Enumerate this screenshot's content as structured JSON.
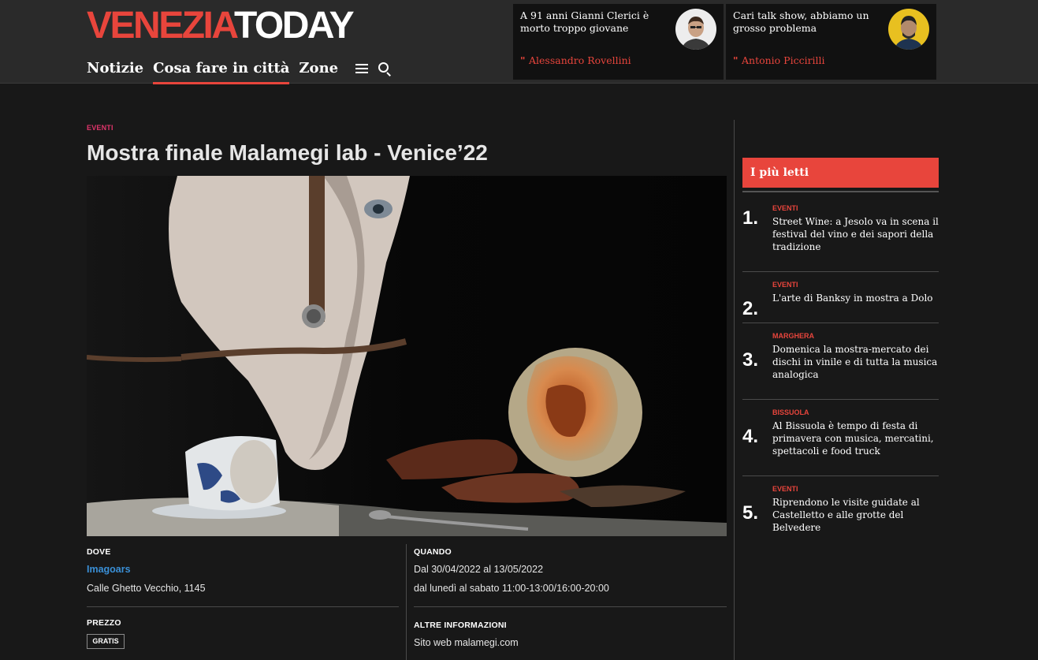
{
  "header": {
    "logo_part1": "VENEZIA",
    "logo_part2": "TODAY",
    "nav": [
      "Notizie",
      "Cosa fare in città",
      "Zone"
    ],
    "opinions": [
      {
        "headline": "A 91 anni Gianni Clerici è morto troppo giovane",
        "author": "Alessandro Rovellini"
      },
      {
        "headline": "Cari talk show, abbiamo un grosso problema",
        "author": "Antonio Piccirilli"
      }
    ],
    "quote_glyph": "\"",
    "icons": [
      "menu-icon",
      "search-icon"
    ]
  },
  "article": {
    "category": "EVENTI",
    "title": "Mostra finale Malamegi lab - Venice’22",
    "dove_label": "DOVE",
    "venue_name": "Imagoars",
    "venue_address": "Calle Ghetto Vecchio, 1145",
    "quando_label": "QUANDO",
    "date_range": "Dal 30/04/2022 al 13/05/2022",
    "schedule": "dal lunedì al sabato 11:00-13:00/16:00-20:00",
    "prezzo_label": "PREZZO",
    "price": "GRATIS",
    "altre_label": "ALTRE INFORMAZIONI",
    "website_prefix": "Sito web",
    "website": "malamegi.com"
  },
  "sidebar": {
    "heading": "I più letti",
    "items": [
      {
        "num": "1.",
        "category": "EVENTI",
        "title": "Street Wine: a Jesolo va in scena il festival del vino e dei sapori della tradizione"
      },
      {
        "num": "2.",
        "category": "EVENTI",
        "title": "L'arte di Banksy in mostra a Dolo"
      },
      {
        "num": "3.",
        "category": "MARGHERA",
        "title": "Domenica la mostra-mercato dei dischi in vinile e di tutta la musica analogica"
      },
      {
        "num": "4.",
        "category": "BISSUOLA",
        "title": "Al Bissuola è tempo di festa di primavera con musica, mercatini, spettacoli e food truck"
      },
      {
        "num": "5.",
        "category": "EVENTI",
        "title": "Riprendono le visite guidate al Castelletto e alle grotte del Belvedere"
      }
    ]
  },
  "colors": {
    "brand_red": "#e8453c",
    "category_pink": "#e0356b",
    "link_blue": "#3a8fd6",
    "background": "#181818",
    "header_bg": "#2a2a2a"
  }
}
